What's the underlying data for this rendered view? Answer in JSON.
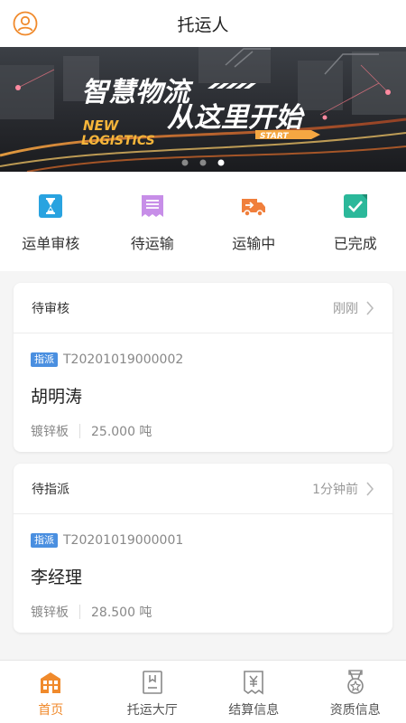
{
  "header": {
    "title": "托运人",
    "profile_icon": "user-circle-icon"
  },
  "banner": {
    "headline": "智慧物流",
    "subhead": "从这里开始",
    "tag_line1": "NEW",
    "tag_line2": "LOGISTICS",
    "start": "START",
    "dots_total": 3,
    "active_dot": 3
  },
  "quick_actions": [
    {
      "label": "运单审核",
      "icon": "hourglass-icon",
      "color": "#29a3e0"
    },
    {
      "label": "待运输",
      "icon": "document-list-icon",
      "color": "#c78ee8"
    },
    {
      "label": "运输中",
      "icon": "truck-icon",
      "color": "#f07f3c"
    },
    {
      "label": "已完成",
      "icon": "check-icon",
      "color": "#2bb89a"
    }
  ],
  "orders": [
    {
      "status": "待审核",
      "time": "刚刚",
      "tag": "指派",
      "order_no": "T20201019000002",
      "name": "胡明涛",
      "material": "镀锌板",
      "weight": "25.000 吨"
    },
    {
      "status": "待指派",
      "time": "1分钟前",
      "tag": "指派",
      "order_no": "T20201019000001",
      "name": "李经理",
      "material": "镀锌板",
      "weight": "28.500 吨"
    }
  ],
  "tabbar": {
    "accent": "#f08a2c",
    "items": [
      {
        "label": "首页",
        "icon": "home-icon",
        "active": true
      },
      {
        "label": "托运大厅",
        "icon": "hall-icon",
        "active": false
      },
      {
        "label": "结算信息",
        "icon": "settlement-icon",
        "active": false
      },
      {
        "label": "资质信息",
        "icon": "qualification-icon",
        "active": false
      }
    ]
  }
}
